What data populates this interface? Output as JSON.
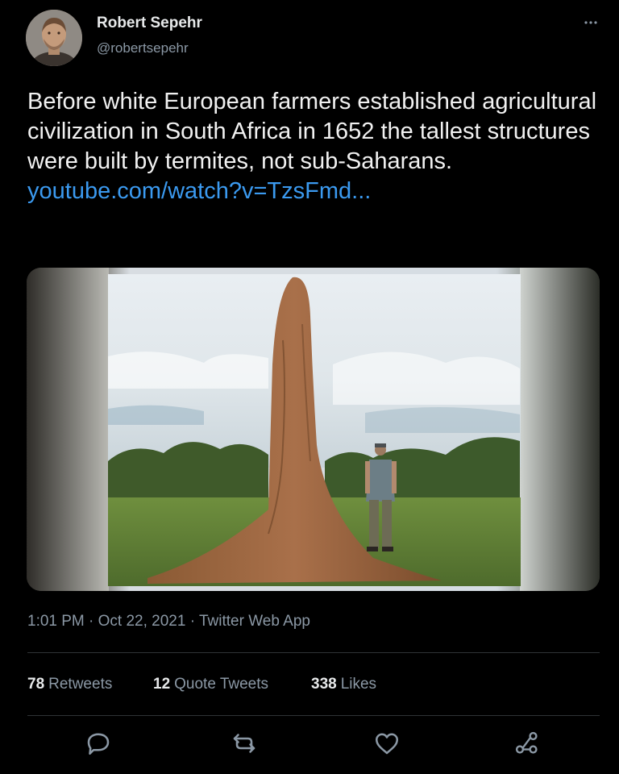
{
  "tweet": {
    "author_name": "Robert Sepehr",
    "author_handle": "@robertsepehr",
    "text": "Before white European farmers established agricultural civilization in South Africa in 1652 the tallest structures were built by termites, not sub-Saharans. ",
    "link_text": "youtube.com/watch?v=TzsFmd...",
    "timestamp": "1:01 PM · Oct 22, 2021 · Twitter Web App"
  },
  "stats": {
    "retweets_count": "78",
    "retweets_label": "Retweets",
    "quotes_count": "12",
    "quotes_label": "Quote Tweets",
    "likes_count": "338",
    "likes_label": "Likes"
  },
  "icons": {
    "more": "more-icon",
    "reply": "reply-icon",
    "retweet": "retweet-icon",
    "like": "like-icon",
    "share": "share-icon"
  },
  "colors": {
    "background": "#000000",
    "text_primary": "#e7e9ea",
    "text_secondary": "#8b98a5",
    "link": "#3b9af0",
    "divider": "#2f3336"
  }
}
